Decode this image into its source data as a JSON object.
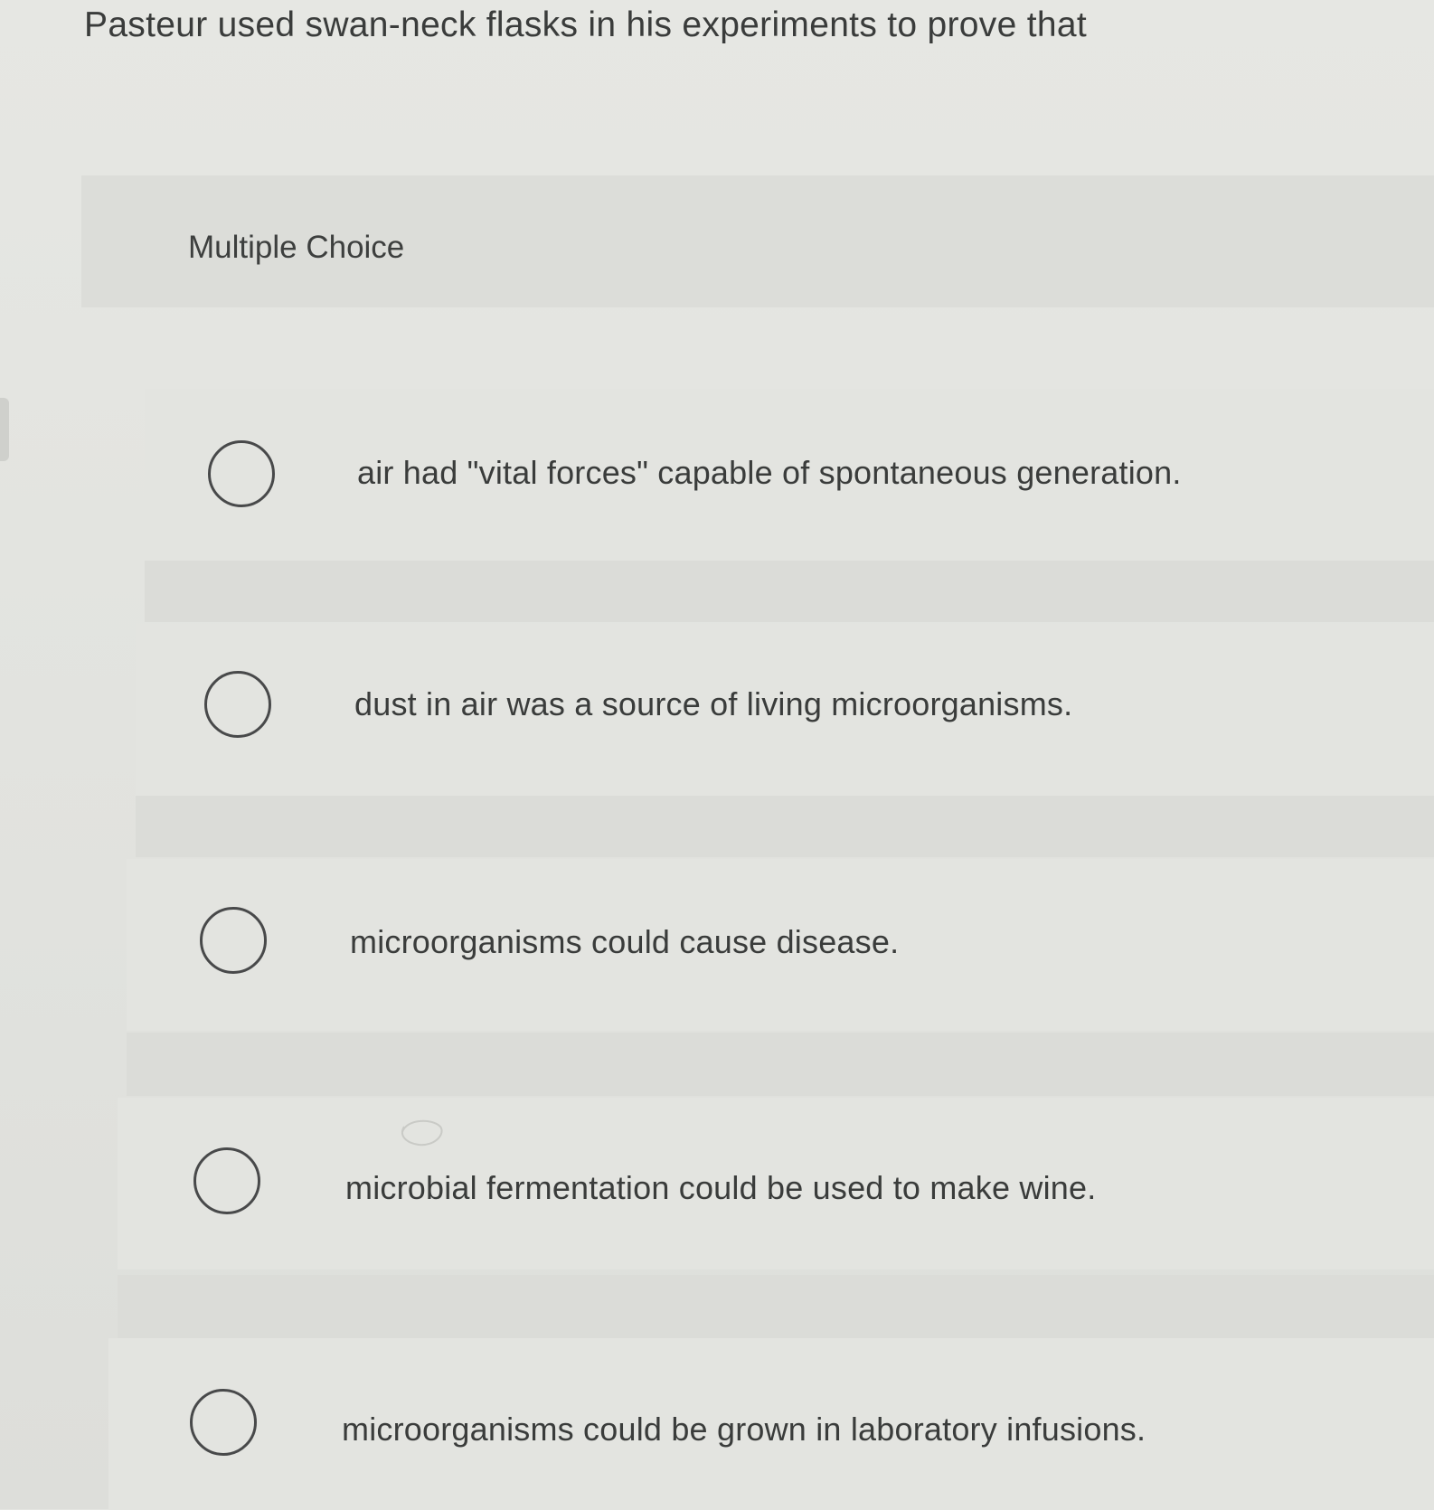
{
  "question": {
    "text": "Pasteur used swan-neck flasks in his experiments to prove that"
  },
  "answer_type": {
    "label": "Multiple Choice"
  },
  "options": [
    {
      "text": "air had \"vital forces\" capable of spontaneous generation.",
      "selected": false
    },
    {
      "text": "dust in air was a source of living microorganisms.",
      "selected": false
    },
    {
      "text": "microorganisms could cause disease.",
      "selected": false
    },
    {
      "text": "microbial fermentation could be used to make wine.",
      "selected": false
    },
    {
      "text": "microorganisms could be grown in laboratory infusions.",
      "selected": false
    }
  ],
  "icons": {
    "radio": "radio-button-empty-icon"
  }
}
